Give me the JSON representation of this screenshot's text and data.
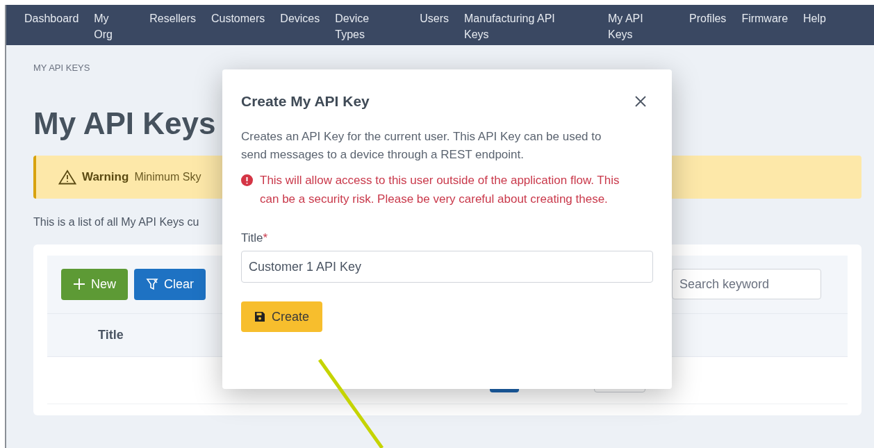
{
  "nav": {
    "items": [
      "Dashboard",
      "My Org",
      "Resellers",
      "Customers",
      "Devices",
      "Device Types",
      "Users",
      "Manufacturing API Keys",
      "My API Keys",
      "Profiles",
      "Firmware",
      "Help"
    ]
  },
  "breadcrumb": "MY API KEYS",
  "page_title": "My API Keys",
  "warning": {
    "label": "Warning",
    "text": "Minimum Sky"
  },
  "description": "This is a list of all My API Keys cu",
  "toolbar": {
    "buttons": [
      {
        "kind": "new",
        "label": "New"
      },
      {
        "kind": "clear",
        "label": "Clear"
      }
    ],
    "search": {
      "placeholder": "Search keyword"
    }
  },
  "table": {
    "columns": [
      "Title"
    ]
  },
  "modal": {
    "title": "Create My API Key",
    "description": "Creates an API Key for the current user. This API Key can be used to send messages to a device through a REST endpoint.",
    "error": "This will allow access to this user outside of the application flow. This can be a security risk. Please be very careful about creating these.",
    "field": {
      "label": "Title",
      "required_mark": "*",
      "value": "Customer 1 API Key"
    },
    "submit": "Create"
  }
}
